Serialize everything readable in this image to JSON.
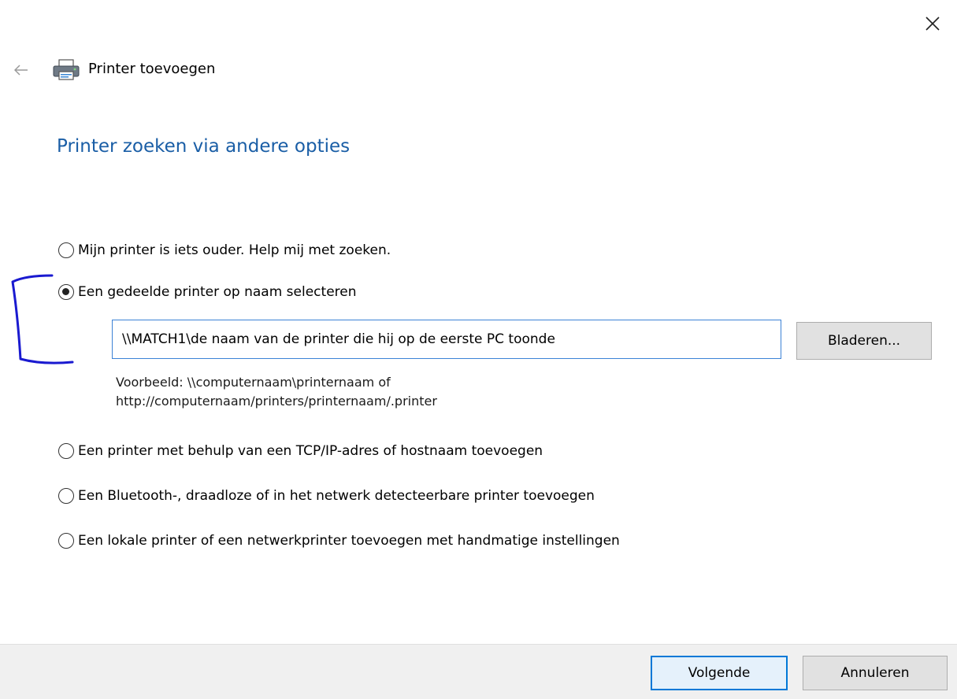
{
  "window": {
    "close_icon": "close-icon",
    "back_icon": "back-arrow-icon"
  },
  "header": {
    "icon": "printer-icon",
    "title": "Printer toevoegen"
  },
  "page": {
    "heading": "Printer zoeken via andere opties"
  },
  "options": [
    {
      "label": "Mijn printer is iets ouder. Help mij met zoeken.",
      "selected": false
    },
    {
      "label": "Een gedeelde printer op naam selecteren",
      "selected": true
    },
    {
      "label": "Een printer met behulp van een TCP/IP-adres of hostnaam toevoegen",
      "selected": false
    },
    {
      "label": "Een Bluetooth-, draadloze of in het netwerk detecteerbare printer toevoegen",
      "selected": false
    },
    {
      "label": "Een lokale printer of een netwerkprinter toevoegen met handmatige instellingen",
      "selected": false
    }
  ],
  "shared_printer": {
    "value": "\\\\MATCH1\\de naam van de printer die hij op de eerste PC toonde",
    "browse_label": "Bladeren...",
    "example_line1": "Voorbeeld: \\\\computernaam\\printernaam of",
    "example_line2": "http://computernaam/printers/printernaam/.printer"
  },
  "footer": {
    "next_label": "Volgende",
    "cancel_label": "Annuleren"
  },
  "colors": {
    "heading": "#1a5ea6",
    "focus_border": "#3c82d6",
    "default_button_border": "#0078d7",
    "annotation": "#1a1ad0"
  }
}
